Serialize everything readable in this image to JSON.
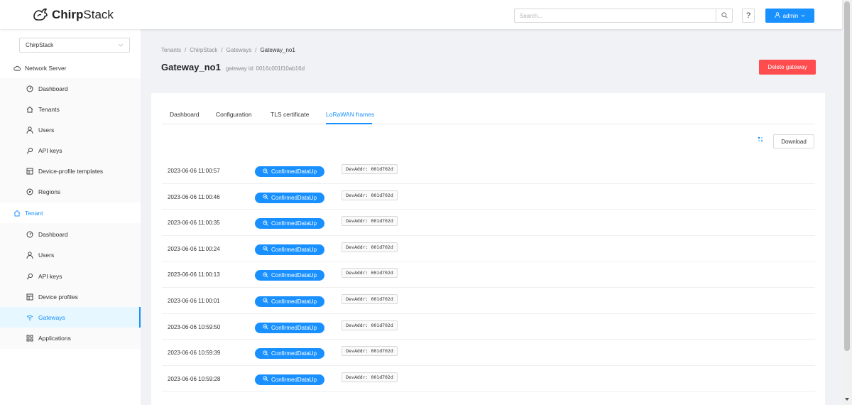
{
  "header": {
    "logo_text": "ChirpStack",
    "search_placeholder": "Search...",
    "help_label": "?",
    "user_label": "admin"
  },
  "sidebar": {
    "tenant_select": "ChirpStack",
    "network_server_label": "Network Server",
    "network_items": [
      {
        "label": "Dashboard",
        "icon": "dashboard-icon"
      },
      {
        "label": "Tenants",
        "icon": "home-icon"
      },
      {
        "label": "Users",
        "icon": "user-icon"
      },
      {
        "label": "API keys",
        "icon": "key-icon"
      },
      {
        "label": "Device-profile templates",
        "icon": "template-icon"
      },
      {
        "label": "Regions",
        "icon": "compass-icon"
      }
    ],
    "tenant_label": "Tenant",
    "tenant_items": [
      {
        "label": "Dashboard",
        "icon": "dashboard-icon"
      },
      {
        "label": "Users",
        "icon": "user-icon"
      },
      {
        "label": "API keys",
        "icon": "key-icon"
      },
      {
        "label": "Device profiles",
        "icon": "profile-icon"
      },
      {
        "label": "Gateways",
        "icon": "wifi-icon",
        "active": true
      },
      {
        "label": "Applications",
        "icon": "appstore-icon"
      }
    ]
  },
  "breadcrumb": [
    "Tenants",
    "ChirpStack",
    "Gateways",
    "Gateway_no1"
  ],
  "breadcrumb_sep": "/",
  "page": {
    "title": "Gateway_no1",
    "subtitle": "gateway id: 0016c001f10ab16d",
    "delete_label": "Delete gateway"
  },
  "tabs": [
    "Dashboard",
    "Configuration",
    "TLS certificate",
    "LoRaWAN frames"
  ],
  "active_tab": "LoRaWAN frames",
  "download_label": "Download",
  "frames": [
    {
      "time": "2023-06-06 11:00:57",
      "type": "ConfirmedDataUp",
      "devaddr": "DevAddr: 001d702d"
    },
    {
      "time": "2023-06-06 11:00:46",
      "type": "ConfirmedDataUp",
      "devaddr": "DevAddr: 001d702d"
    },
    {
      "time": "2023-06-06 11:00:35",
      "type": "ConfirmedDataUp",
      "devaddr": "DevAddr: 001d702d"
    },
    {
      "time": "2023-06-06 11:00:24",
      "type": "ConfirmedDataUp",
      "devaddr": "DevAddr: 001d702d"
    },
    {
      "time": "2023-06-06 11:00:13",
      "type": "ConfirmedDataUp",
      "devaddr": "DevAddr: 001d702d"
    },
    {
      "time": "2023-06-06 11:00:01",
      "type": "ConfirmedDataUp",
      "devaddr": "DevAddr: 001d702d"
    },
    {
      "time": "2023-06-06 10:59:50",
      "type": "ConfirmedDataUp",
      "devaddr": "DevAddr: 001d702d"
    },
    {
      "time": "2023-06-06 10:59:39",
      "type": "ConfirmedDataUp",
      "devaddr": "DevAddr: 001d702d"
    },
    {
      "time": "2023-06-06 10:59:28",
      "type": "ConfirmedDataUp",
      "devaddr": "DevAddr: 001d702d"
    }
  ],
  "colors": {
    "primary": "#1890ff",
    "danger": "#ff4d4f",
    "background": "#f0f2f5"
  }
}
